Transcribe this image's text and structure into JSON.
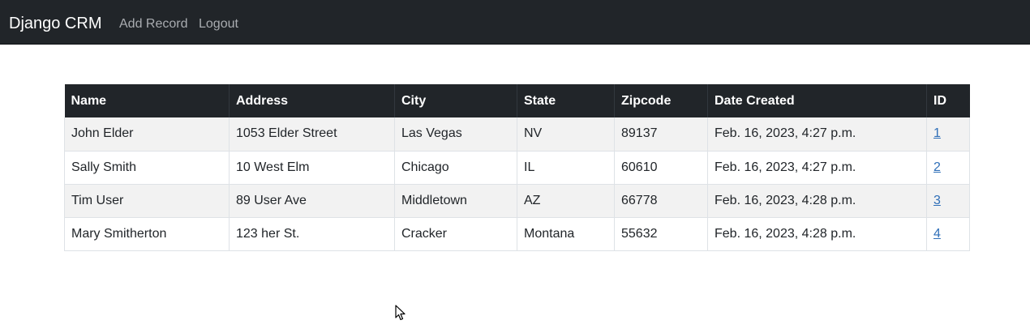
{
  "navbar": {
    "brand": "Django CRM",
    "links": [
      {
        "label": "Add Record"
      },
      {
        "label": "Logout"
      }
    ]
  },
  "table": {
    "headers": [
      "Name",
      "Address",
      "City",
      "State",
      "Zipcode",
      "Date Created",
      "ID"
    ],
    "rows": [
      [
        "John Elder",
        "1053 Elder Street",
        "Las Vegas",
        "NV",
        "89137",
        "Feb. 16, 2023, 4:27 p.m.",
        "1"
      ],
      [
        "Sally Smith",
        "10 West Elm",
        "Chicago",
        "IL",
        "60610",
        "Feb. 16, 2023, 4:27 p.m.",
        "2"
      ],
      [
        "Tim User",
        "89 User Ave",
        "Middletown",
        "AZ",
        "66778",
        "Feb. 16, 2023, 4:28 p.m.",
        "3"
      ],
      [
        "Mary Smitherton",
        "123 her St.",
        "Cracker",
        "Montana",
        "55632",
        "Feb. 16, 2023, 4:28 p.m.",
        "4"
      ]
    ]
  },
  "colors": {
    "navbar_bg": "#212529",
    "table_header_bg": "#212529",
    "stripe_bg": "#f2f2f2",
    "link": "#2f6fb8"
  }
}
